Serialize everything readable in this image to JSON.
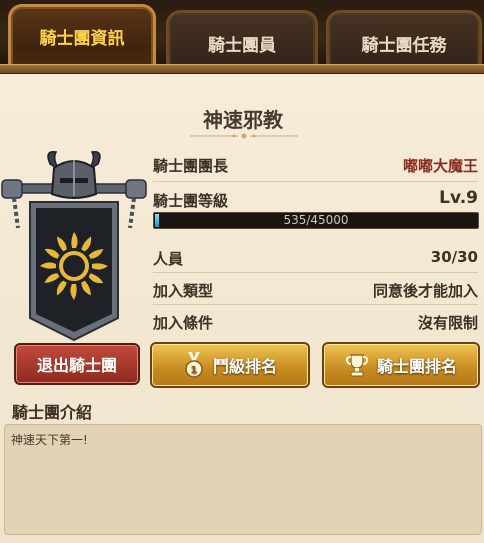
{
  "tabs": [
    {
      "label": "騎士團資訊",
      "active": true
    },
    {
      "label": "騎士團員",
      "active": false
    },
    {
      "label": "騎士團任務",
      "active": false
    }
  ],
  "guild": {
    "name": "神速邪教",
    "leader_label": "騎士團團長",
    "leader_value": "嘟嘟大魔王",
    "level_label": "騎士團等級",
    "level_value": "Lv.9",
    "exp_text": "535/45000",
    "exp_progress": 0.0119,
    "members_label": "人員",
    "members_value": "30/30",
    "join_type_label": "加入類型",
    "join_type_value": "同意後才能加入",
    "join_condition_label": "加入條件",
    "join_condition_value": "沒有限制"
  },
  "buttons": {
    "leave": "退出騎士團",
    "rank_level": "鬥級排名",
    "rank_guild": "騎士團排名"
  },
  "icons": {
    "emblem": "knight-banner-sun-icon",
    "medal": "medal-icon",
    "trophy": "trophy-icon"
  },
  "intro": {
    "title": "騎士團介紹",
    "text": "神速天下第一!"
  },
  "colors": {
    "active_tab_text": "#ffd24a",
    "leader_name": "#8a2d1e",
    "leave_button": "#a83a2e",
    "gold_button": "#d9a035",
    "exp_fill": "#3fb6e8"
  }
}
